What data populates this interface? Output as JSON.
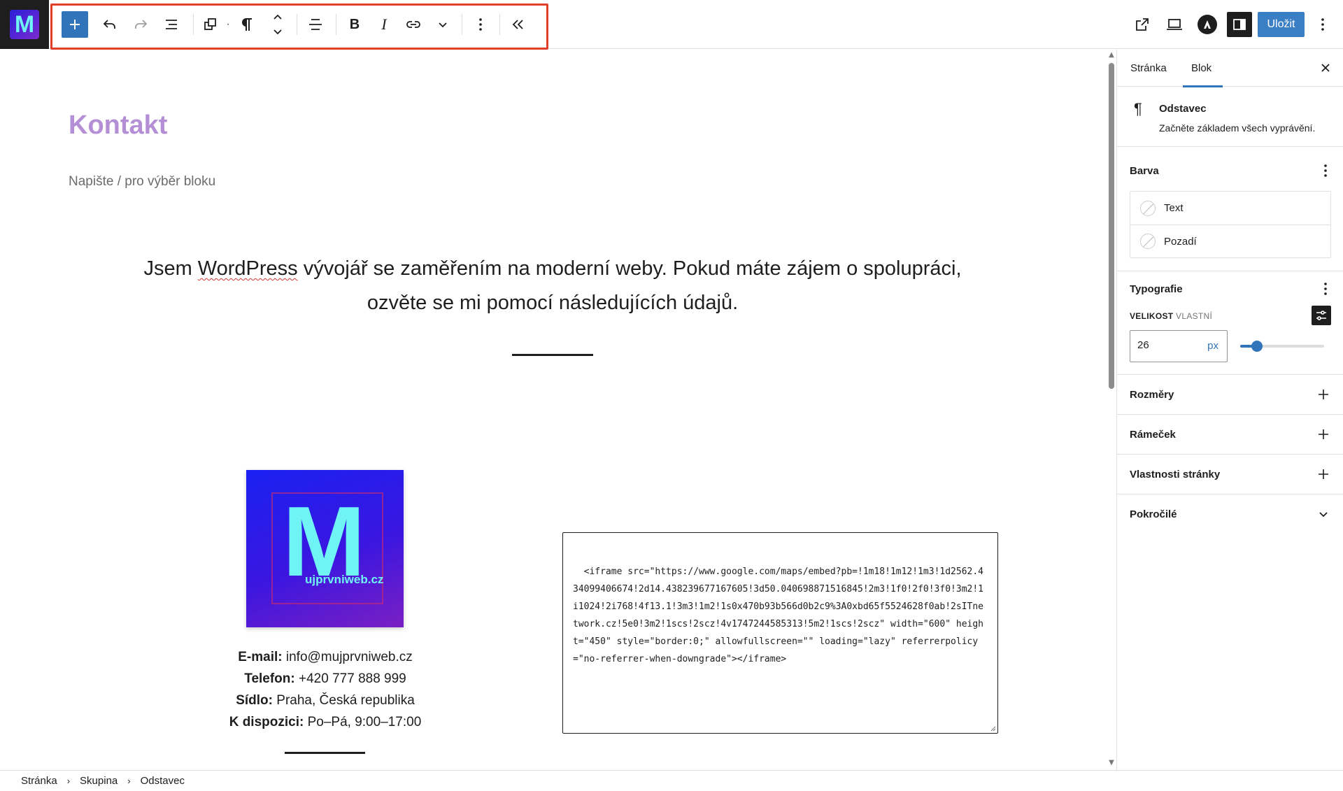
{
  "app": {
    "save_label": "Uložit"
  },
  "editor": {
    "page_title": "Kontakt",
    "placeholder": "Napište / pro výběr bloku",
    "intro_before": "Jsem ",
    "intro_spell": "WordPress",
    "intro_after": " vývojář se zaměřením na moderní weby. Pokud máte zájem o spolupráci, ozvěte se mi pomocí následujících údajů.",
    "logo": {
      "letter": "M",
      "text": "ujprvniweb.cz"
    },
    "contact": [
      {
        "label": "E-mail:",
        "value": " info@mujprvniweb.cz"
      },
      {
        "label": "Telefon:",
        "value": " +420 777 888 999"
      },
      {
        "label": "Sídlo:",
        "value": " Praha, Česká republika"
      },
      {
        "label": "K dispozici:",
        "value": " Po–Pá, 9:00–17:00"
      }
    ],
    "html_code": "<iframe src=\"https://www.google.com/maps/embed?pb=!1m18!1m12!1m3!1d2562.434099406674!2d14.438239677167605!3d50.040698871516845!2m3!1f0!2f0!3f0!3m2!1i1024!2i768!4f13.1!3m3!1m2!1s0x470b93b566d0b2c9%3A0xbd65f5524628f0ab!2sITnetwork.cz!5e0!3m2!1scs!2scz!4v1747244585313!5m2!1scs!2scz\" width=\"600\" height=\"450\" style=\"border:0;\" allowfullscreen=\"\" loading=\"lazy\" referrerpolicy=\"no-referrer-when-downgrade\"></iframe>"
  },
  "breadcrumb": [
    "Stránka",
    "Skupina",
    "Odstavec"
  ],
  "sidebar": {
    "tabs": [
      "Stránka",
      "Blok"
    ],
    "active_tab": "Blok",
    "block": {
      "name": "Odstavec",
      "description": "Začněte základem všech vyprávění.",
      "icon": "¶"
    },
    "color": {
      "title": "Barva",
      "items": [
        "Text",
        "Pozadí"
      ]
    },
    "typography": {
      "title": "Typografie",
      "size_label": "VELIKOST",
      "size_mode": "VLASTNÍ",
      "size_value": "26",
      "size_unit": "px",
      "slider_percent": 20
    },
    "panels": [
      "Rozměry",
      "Rámeček",
      "Vlastnosti stránky",
      "Pokročilé"
    ]
  },
  "colors": {
    "accent": "#3274b9",
    "title": "#b48fd6",
    "highlight": "#e0402a",
    "logo_cyan": "#6ff3f5"
  },
  "icons": [
    "site-logo",
    "plus-icon",
    "undo-icon",
    "redo-icon",
    "list-view-icon",
    "duplicate-icon",
    "paragraph-icon",
    "move-up-down-icon",
    "align-icon",
    "bold-icon",
    "italic-icon",
    "link-icon",
    "chevron-down-icon",
    "more-options-icon",
    "collapse-toolbar-icon",
    "external-view-icon",
    "device-preview-icon",
    "astra-icon",
    "settings-sidebar-icon",
    "close-icon",
    "sliders-icon"
  ]
}
